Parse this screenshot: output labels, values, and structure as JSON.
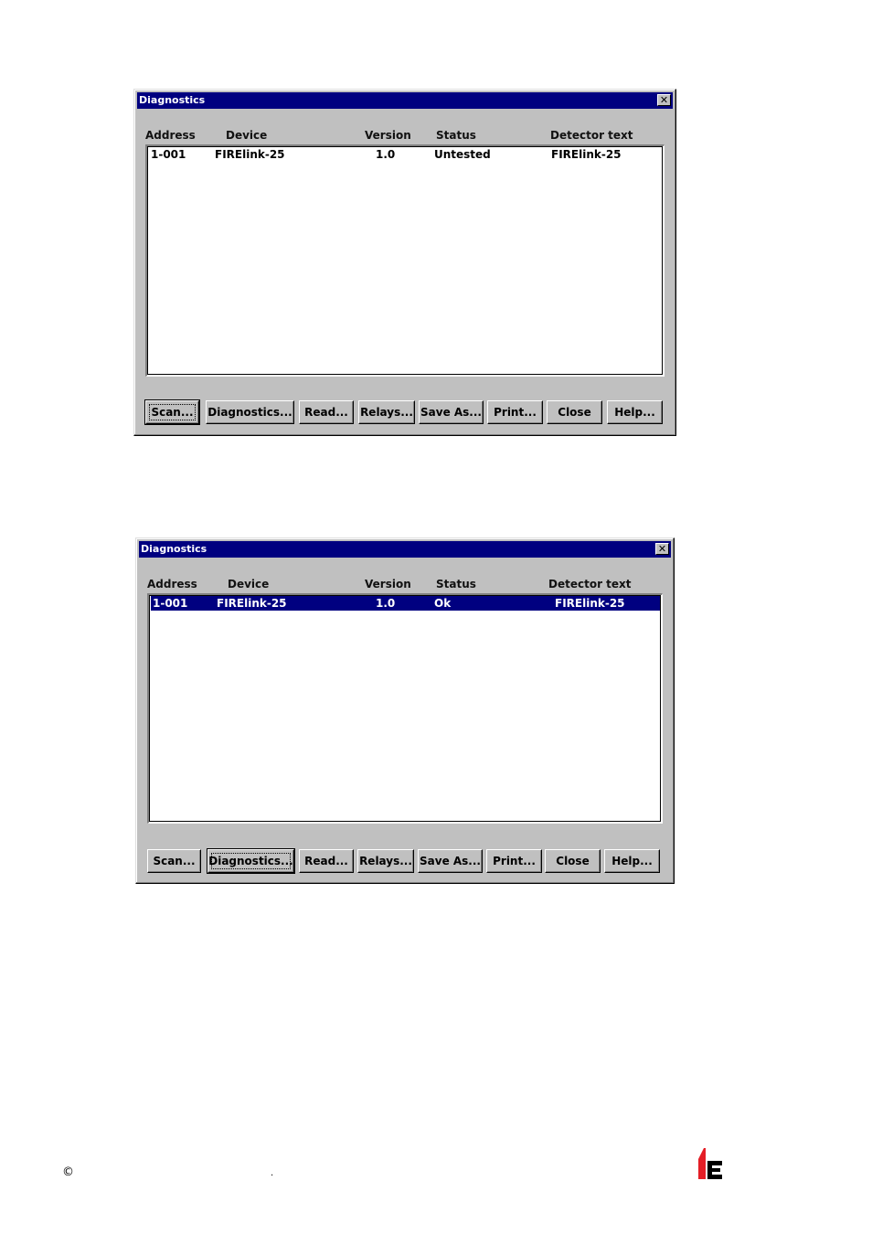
{
  "dialogs": [
    {
      "title": "Diagnostics",
      "columns": [
        "Address",
        "Device",
        "Version",
        "Status",
        "Detector text"
      ],
      "rows": [
        {
          "address": "1-001",
          "device": "FIRElink-25",
          "version": "1.0",
          "status": "Untested",
          "detector_text": "FIRElink-25"
        }
      ],
      "selected_row": "none",
      "focused_button": "Scan...",
      "buttons": [
        "Scan...",
        "Diagnostics...",
        "Read...",
        "Relays...",
        "Save As...",
        "Print...",
        "Close",
        "Help..."
      ]
    },
    {
      "title": "Diagnostics",
      "columns": [
        "Address",
        "Device",
        "Version",
        "Status",
        "Detector text"
      ],
      "rows": [
        {
          "address": "1-001",
          "device": "FIRElink-25",
          "version": "1.0",
          "status": "Ok",
          "detector_text": "FIRElink-25"
        }
      ],
      "selected_row": "1-001",
      "focused_button": "Diagnostics...",
      "buttons": [
        "Scan...",
        "Diagnostics...",
        "Read...",
        "Relays...",
        "Save As...",
        "Print...",
        "Close",
        "Help..."
      ]
    }
  ],
  "footer": {
    "copyright_symbol": "©",
    "dot": "."
  },
  "colors": {
    "titlebar": "#000080",
    "dialog_face": "#c0c0c0",
    "selection": "#000080",
    "logo_red": "#e41e26",
    "logo_black": "#000000"
  },
  "icons": {
    "close": "close-x-icon",
    "logo": "brand-logo-icon"
  }
}
